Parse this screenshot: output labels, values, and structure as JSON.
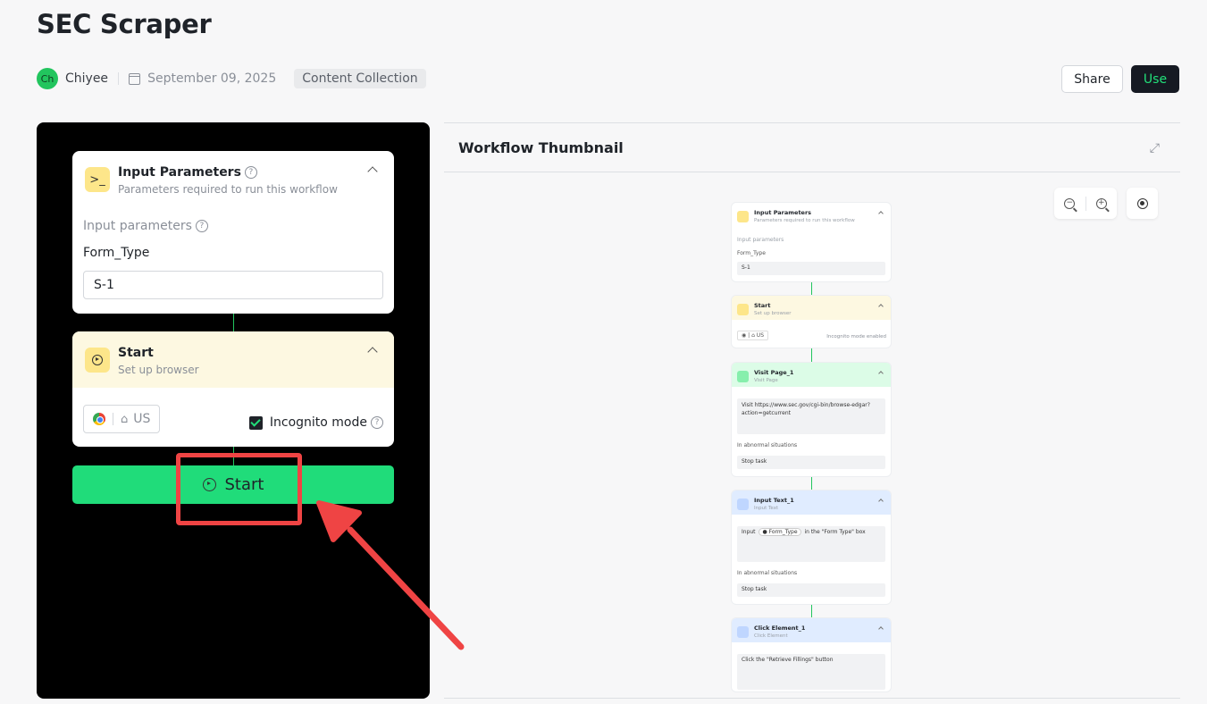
{
  "page": {
    "title": "SEC Scraper"
  },
  "meta": {
    "avatar_initials": "Ch",
    "author": "Chiyee",
    "date": "September 09, 2025",
    "category": "Content Collection"
  },
  "actions": {
    "share_label": "Share",
    "use_label": "Use"
  },
  "workflow_panel": {
    "input_card": {
      "title": "Input Parameters",
      "subtitle": "Parameters required to run this workflow",
      "section_label": "Input parameters",
      "field_label": "Form_Type",
      "field_value": "S-1"
    },
    "start_card": {
      "title": "Start",
      "subtitle": "Set up browser",
      "region": "US",
      "incognito_label": "Incognito mode",
      "incognito_checked": true
    },
    "start_button_label": "Start"
  },
  "thumbnail": {
    "title": "Workflow Thumbnail",
    "nodes": {
      "input": {
        "title": "Input Parameters",
        "subtitle": "Parameters required to run this workflow",
        "section": "Input parameters",
        "field": "Form_Type",
        "value": "S-1"
      },
      "start": {
        "title": "Start",
        "subtitle": "Set up browser",
        "region": "US",
        "incognito": "Incognito mode enabled"
      },
      "visit": {
        "title": "Visit Page_1",
        "subtitle": "Visit Page",
        "body": "Visit https://www.sec.gov/cgi-bin/browse-edgar?action=getcurrent",
        "abnormal": "In abnormal situations",
        "action": "Stop task"
      },
      "input_text": {
        "title": "Input Text_1",
        "subtitle": "Input Text",
        "body_prefix": "Input",
        "token": "Form_Type",
        "body_suffix": "in the \"Form Type\" box",
        "abnormal": "In abnormal situations",
        "action": "Stop task"
      },
      "click": {
        "title": "Click Element_1",
        "subtitle": "Click Element",
        "body": "Click the \"Retrieve Fillings\" button"
      }
    }
  },
  "colors": {
    "accent_green": "#20dc7a",
    "dark": "#161a23",
    "annotation_red": "#ef4444"
  }
}
